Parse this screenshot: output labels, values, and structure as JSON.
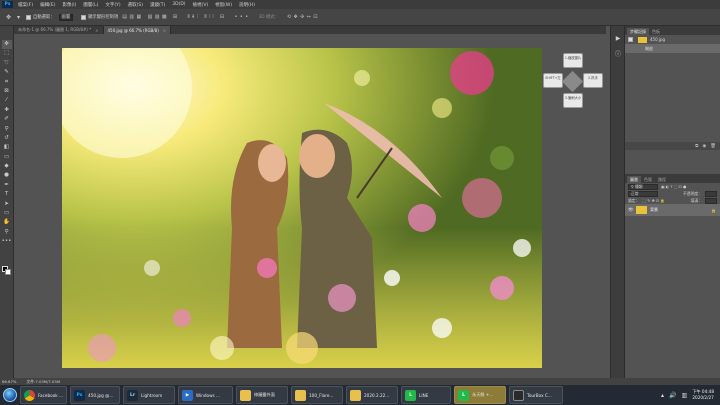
{
  "menu": {
    "logo": "Ps",
    "items": [
      "檔案(F)",
      "編輯(E)",
      "影像(I)",
      "圖層(L)",
      "文字(Y)",
      "選取(S)",
      "濾鏡(T)",
      "3D(D)",
      "檢視(V)",
      "視窗(W)",
      "說明(H)"
    ]
  },
  "options": {
    "auto_select_label": "自動選取：",
    "auto_select_value": "圖層",
    "transform_label": "顯示變形控制項",
    "mode_3d_label": "3D 模式："
  },
  "tabs": [
    {
      "label": "未命名-1 @ 66.7% (圖層 1, RGB/8#) *"
    },
    {
      "label": "450.jpg @ 66.7% (RGB/8)"
    }
  ],
  "touchbar": {
    "top": "1.縮放圖片",
    "left": "SHIFT+左",
    "right": "2.抓手",
    "bottom": "3.筆刷大小"
  },
  "history_panel": {
    "tabs": [
      "步驟記錄",
      "色板"
    ],
    "items": [
      {
        "label": "450.jpg"
      },
      {
        "label": "開啟"
      }
    ]
  },
  "layers_panel": {
    "tabs": [
      "圖層",
      "色版",
      "路徑"
    ],
    "search_label": "種類",
    "blend_mode": "正常",
    "opacity_label": "不透明度：",
    "lock_label": "鎖定：",
    "fill_label": "填滿：",
    "layers": [
      {
        "name": "背景"
      }
    ]
  },
  "status": {
    "zoom": "66.67%",
    "doc": "文件:7.03M/7.03M"
  },
  "taskbar": {
    "apps": [
      {
        "label": "Facebook ...",
        "icon": "chrome-icon",
        "color": "#e0e0e0"
      },
      {
        "label": "450.jpg @...",
        "icon": "ps-icon",
        "color": "#0d2b4d"
      },
      {
        "label": "Lightroom",
        "icon": "lr-icon",
        "color": "#1c2b3a"
      },
      {
        "label": "Windows ...",
        "icon": "media-icon",
        "color": "#2c6cc4"
      },
      {
        "label": "修圖靈外面",
        "icon": "folder-icon",
        "color": "#e8c04e"
      },
      {
        "label": "100_Flare...",
        "icon": "folder-icon",
        "color": "#e8c04e"
      },
      {
        "label": "2020.2.22...",
        "icon": "folder-icon",
        "color": "#e8c04e"
      },
      {
        "label": "LINE",
        "icon": "line-icon",
        "color": "#22b94a"
      },
      {
        "label": "永天鮮 +...",
        "icon": "line-icon",
        "color": "#22b94a"
      },
      {
        "label": "TourBox C...",
        "icon": "tourbox-icon",
        "color": "#2a2a2a"
      }
    ],
    "clock_time": "下午 04:48",
    "clock_date": "2020/2/27"
  }
}
